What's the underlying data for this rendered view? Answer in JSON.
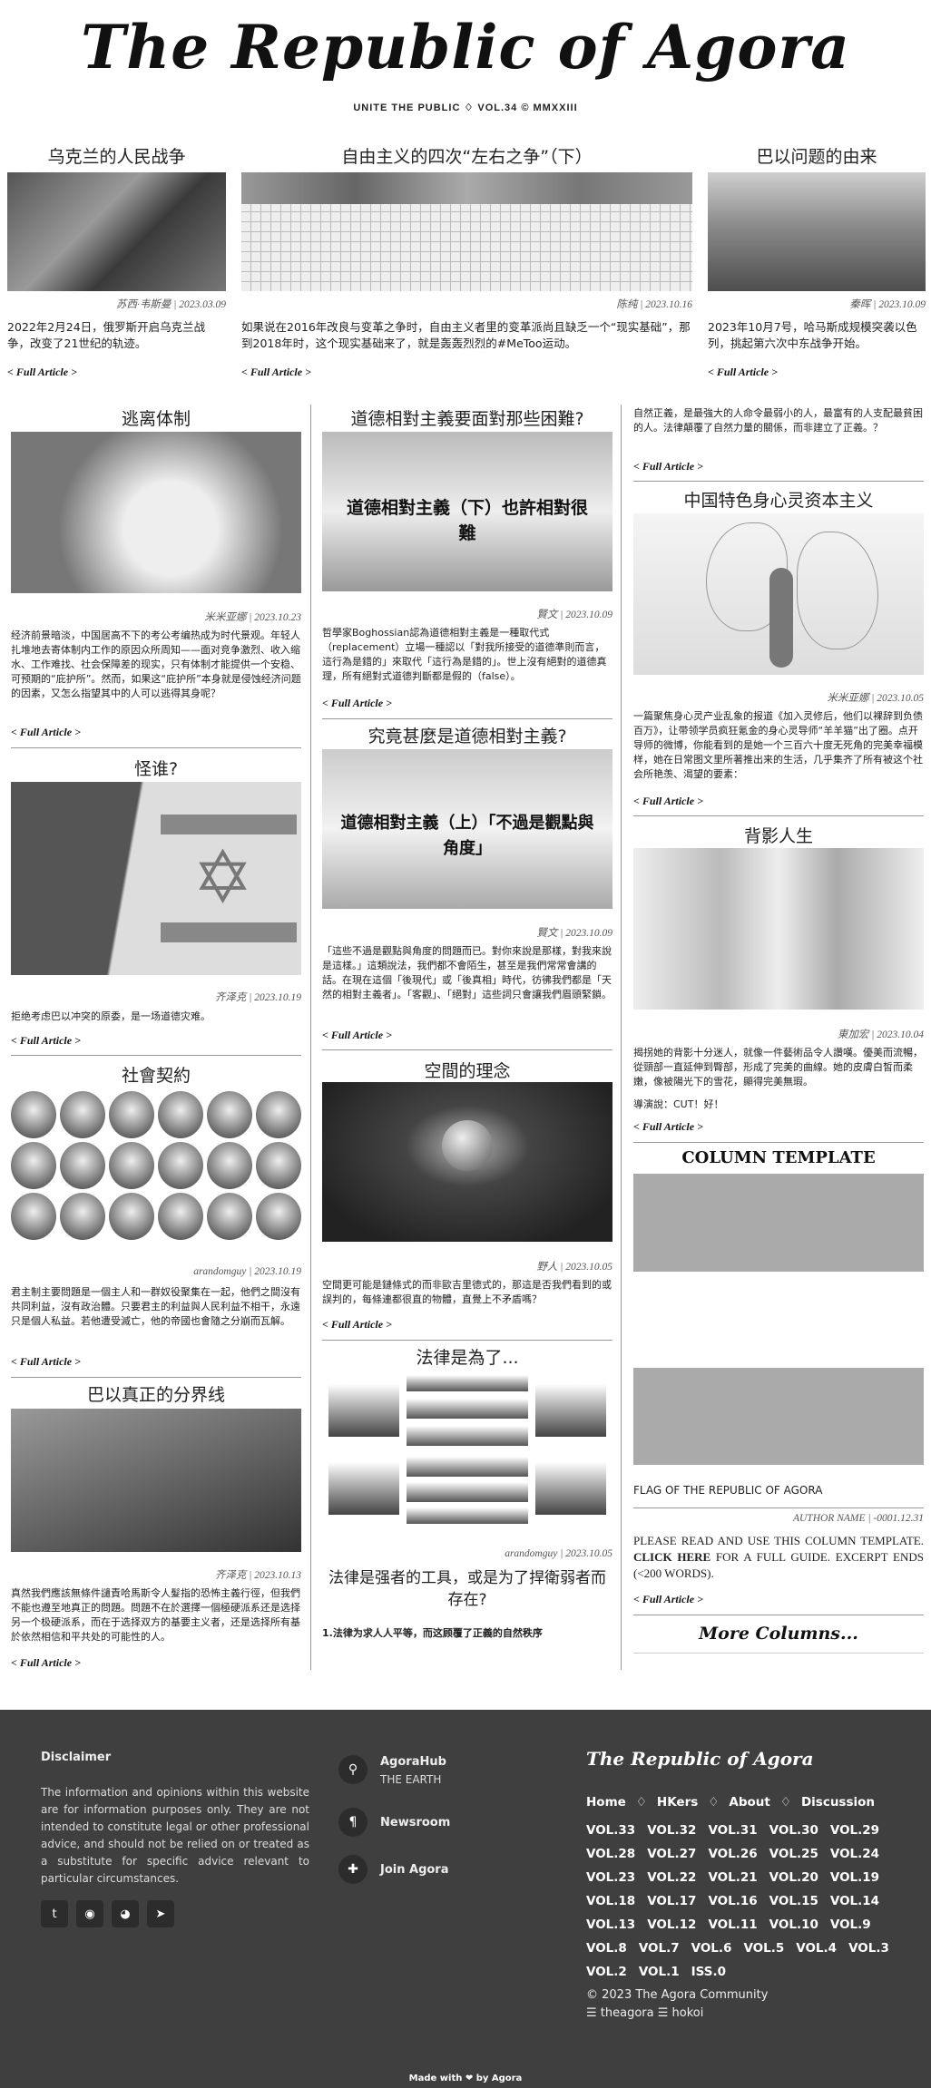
{
  "masthead": {
    "title": "The Republic of Agora",
    "subtitle": "UNITE THE PUBLIC ♢ VOL.34 © MMXXIII"
  },
  "full_article_label": "< Full Article >",
  "top_articles": [
    {
      "title": "乌克兰的人民战争",
      "byline": "苏西·韦斯曼 | 2023.03.09",
      "excerpt": "2022年2月24日，俄罗斯开启乌克兰战争，改变了21世纪的轨迹。"
    },
    {
      "title": "自由主义的四次“左右之争”（下）",
      "byline": "陈纯 | 2023.10.16",
      "excerpt": "如果说在2016年改良与变革之争时，自由主义者里的变革派尚且缺乏一个“现实基础”，那到2018年时，这个现实基础来了，就是轰轰烈烈的#MeToo运动。"
    },
    {
      "title": "巴以问题的由来",
      "byline": "秦晖 | 2023.10.09",
      "excerpt": "2023年10月7号，哈马斯成规模突袭以色列，挑起第六次中东战争开始。"
    }
  ],
  "col1": [
    {
      "title": "逃离体制",
      "byline": "米米亚娜 | 2023.10.23",
      "excerpt": "经济前景暗淡，中国居高不下的考公考编热成为时代景观。年轻人扎堆地去寄体制内工作的原因众所周知——面对竞争激烈、收入缩水、工作难找、社会保障差的现实，只有体制才能提供一个安稳、可预期的“庇护所”。然而，如果这“庇护所”本身就是侵蚀经济问题的因素，又怎么指望其中的人可以逃得其身呢？"
    },
    {
      "title": "怪谁?",
      "byline": "齐泽克 | 2023.10.19",
      "excerpt": "拒绝考虑巴以冲突的原委，是一场道德灾难。"
    },
    {
      "title": "社會契約",
      "byline": "arandomguy | 2023.10.19",
      "excerpt": "君主制主要問題是一個主人和一群奴役聚集在一起，他們之間沒有共同利益，沒有政治體。只要君主的利益與人民利益不相干，永遠只是個人私益。若他遭受滅亡，他的帝國也會隨之分崩而瓦解。"
    },
    {
      "title": "巴以真正的分界线",
      "byline": "齐泽克 | 2023.10.13",
      "excerpt": "真然我們應該無條件譴責哈馬斯令人髮指的恐怖主義行徑，但我們不能也遵至地真正的問題。問題不在於選擇一個極硬派系还是选择另一个极硬派系，而在于选择双方的基要主义者，还是选择所有基於依然相信和平共处的可能性的人。"
    }
  ],
  "col2": [
    {
      "title": "道德相對主義要面對那些困難?",
      "img_caption": "道德相對主義（下）也許相對很難",
      "byline": "賢文 | 2023.10.09",
      "excerpt": "哲學家Boghossian認為道德相對主義是一種取代式（replacement）立場一種認以「對我所接受的道德準則而言，這行為是錯的」來取代「這行為是錯的」。世上沒有絕對的道德真理，所有絕對式道德判斷都是假的（false）。"
    },
    {
      "title": "究竟甚麼是道德相對主義?",
      "img_caption": "道德相對主義（上）「不過是觀點與角度」",
      "byline": "賢文 | 2023.10.09",
      "excerpt": "「這些不過是觀點與角度的問題而已。對你來說是那樣，對我來說是這樣。」這類說法，我們都不會陌生，甚至是我們常常會講的話。在現在這個「後現代」或「後真相」時代，彷彿我們都是「天然的相對主義者」。「客觀」、「絕對」這些詞只會讓我們眉頭緊鎖。"
    },
    {
      "title": "空間的理念",
      "byline": "野人 | 2023.10.05",
      "excerpt": "空間更可能是鏈條式的而非歐吉里德式的，那這是否我們看到的或誤判的，每條連都很直的物體，直覺上不矛盾嗎？"
    },
    {
      "title": "法律是為了...",
      "byline": "arandomguy | 2023.10.05",
      "subtitle": "法律是强者的工具，或是为了捍衛弱者而存在?",
      "excerpt": "1.法律为求人人平等，而这顾覆了正義的自然秩序"
    }
  ],
  "col3": [
    {
      "excerpt": "自然正義，是最強大的人命令最弱小的人，最富有的人支配最貧困的人。法律顛覆了自然力量的關係，而非建立了正義。？"
    },
    {
      "title": "中国特色身心灵资本主义",
      "byline": "米米亚娜 | 2023.10.05",
      "excerpt": "一篇聚焦身心灵产业乱象的报道《加入灵修后，他们以裸辞到负债百万》，让带领学员疯狂氪金的身心灵导师“羊羊猫”出了圈。点开导师的微博，你能看到的是她一个三百六十度无死角的完美幸福模样，她在日常图文里所著推出来的生活，几乎集齐了所有被这个社会所艳羡、渴望的要素："
    },
    {
      "title": "背影人生",
      "byline": "東加宏 | 2023.10.04",
      "excerpt": "揭拐她的背影十分迷人，就像一件藝術品令人讚嘆。優美而流暢，從頸部一直延伸到臀部，形成了完美的曲線。她的皮膚白皙而柔嫩，像被陽光下的雪花，顯得完美無瑕。",
      "excerpt2": "導演說：CUT！好！"
    },
    {
      "title": "COLUMN TEMPLATE",
      "caption": "FLAG OF THE REPUBLIC OF AGORA",
      "byline": "AUTHOR NAME | -0001.12.31",
      "excerpt_pre": "PLEASE READ AND USE THIS COLUMN TEMPLATE. ",
      "excerpt_link": "CLICK HERE",
      "excerpt_post": " FOR A FULL GUIDE. EXCERPT ENDS (<200 WORDS)."
    },
    {
      "more": "More Columns..."
    }
  ],
  "footer": {
    "disclaimer_title": "Disclaimer",
    "disclaimer_text": "The information and opinions within this website are for information purposes only. They are not intended to constitute legal or other professional advice, and should not be relied on or treated as a substitute for specific advice relevant to particular circumstances.",
    "links": [
      {
        "label": "AgoraHub",
        "sub": "THE EARTH",
        "icon": "location-pin-icon"
      },
      {
        "label": "Newsroom",
        "icon": "paragraph-icon"
      },
      {
        "label": "Join Agora",
        "icon": "puzzle-icon"
      }
    ],
    "brand": "The Republic of Agora",
    "nav": [
      "Home",
      "HKers",
      "About",
      "Discussion"
    ],
    "volumes": [
      [
        "VOL.33",
        "VOL.32",
        "VOL.31",
        "VOL.30",
        "VOL.29"
      ],
      [
        "VOL.28",
        "VOL.27",
        "VOL.26",
        "VOL.25",
        "VOL.24"
      ],
      [
        "VOL.23",
        "VOL.22",
        "VOL.21",
        "VOL.20",
        "VOL.19"
      ],
      [
        "VOL.18",
        "VOL.17",
        "VOL.16",
        "VOL.15",
        "VOL.14"
      ],
      [
        "VOL.13",
        "VOL.12",
        "VOL.11",
        "VOL.10",
        "VOL.9"
      ],
      [
        "VOL.8",
        "VOL.7",
        "VOL.6",
        "VOL.5",
        "VOL.4",
        "VOL.3"
      ],
      [
        "VOL.2",
        "VOL.1",
        "ISS.0"
      ]
    ],
    "copyright": "© 2023 The Agora Community",
    "credits": "☰ theagora ☰ hokoi",
    "made_with": "Made with ❤ by Agora"
  }
}
